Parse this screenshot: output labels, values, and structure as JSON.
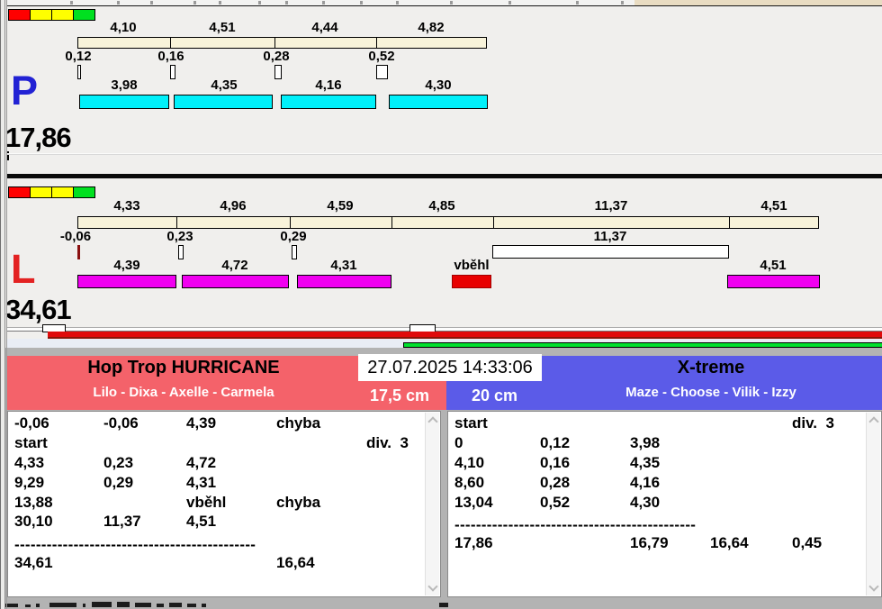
{
  "colors": {
    "panel_bg": "#f0efed",
    "split_bar": "#f8f3da",
    "dog_bar_right": "#00f0fa",
    "dog_bar_left": "#f000f0",
    "fault_bar": "#e80000",
    "traffic_red": "#ff0000",
    "traffic_yellow": "#ffff00",
    "traffic_green": "#00e020",
    "p_letter": "#2222d4",
    "l_letter": "#e32222",
    "team_left_bg": "#f4626a",
    "team_right_bg": "#5b5be8",
    "progress_red": "#e00b0b",
    "progress_green": "#00e12e"
  },
  "lane_p": {
    "label": "P",
    "total": "17,86",
    "splits": [
      "4,10",
      "4,51",
      "4,44",
      "4,82"
    ],
    "exchanges": [
      "0,12",
      "0,16",
      "0,28",
      "0,52"
    ],
    "dogs": [
      "3,98",
      "4,35",
      "4,16",
      "4,30"
    ]
  },
  "lane_l": {
    "label": "L",
    "total": "34,61",
    "splits": [
      "4,33",
      "4,96",
      "4,59",
      "4,85",
      "11,37",
      "4,51"
    ],
    "exchanges": [
      "-0,06",
      "0,23",
      "0,29"
    ],
    "gap": "11,37",
    "dogs": [
      "4,39",
      "4,72",
      "4,31"
    ],
    "fault": "vběhl",
    "last_dog": "4,51"
  },
  "clock": "27.07.2025 14:33:06",
  "left_panel": {
    "team": "Hop Trop HURRICANE",
    "dogs": "Lilo - Dixa - Axelle - Carmela",
    "jump_height": "17,5 cm",
    "rows": [
      {
        "c0": "-0,06",
        "c1": "-0,06",
        "c2": "4,39",
        "c3": "chyba"
      },
      {
        "c0": "start",
        "c4": "div.  3"
      },
      {
        "c0": "4,33",
        "c1": "0,23",
        "c2": "4,72"
      },
      {
        "c0": "9,29",
        "c1": "0,29",
        "c2": "4,31"
      },
      {
        "c0": "13,88",
        "c2": "vběhl",
        "c3": "chyba"
      },
      {
        "c0": "30,10",
        "c1": "11,37",
        "c2": "4,51"
      }
    ],
    "dash": "---------------------------------------------",
    "total_row": {
      "c0": "34,61",
      "c3": "16,64"
    }
  },
  "right_panel": {
    "team": "X-treme",
    "dogs": "Maze - Choose - Vilik - Izzy",
    "jump_height": "20 cm",
    "rows": [
      {
        "c0": "start",
        "c4": "div.  3"
      },
      {
        "c0": "0",
        "c1": "0,12",
        "c2": "3,98"
      },
      {
        "c0": "4,10",
        "c1": "0,16",
        "c2": "4,35"
      },
      {
        "c0": "8,60",
        "c1": "0,28",
        "c2": "4,16"
      },
      {
        "c0": "13,04",
        "c1": "0,52",
        "c2": "4,30"
      }
    ],
    "dash": "---------------------------------------------",
    "total_row": {
      "c0": "17,86",
      "c2": "16,79",
      "c3": "16,64",
      "c4": "0,45"
    }
  }
}
